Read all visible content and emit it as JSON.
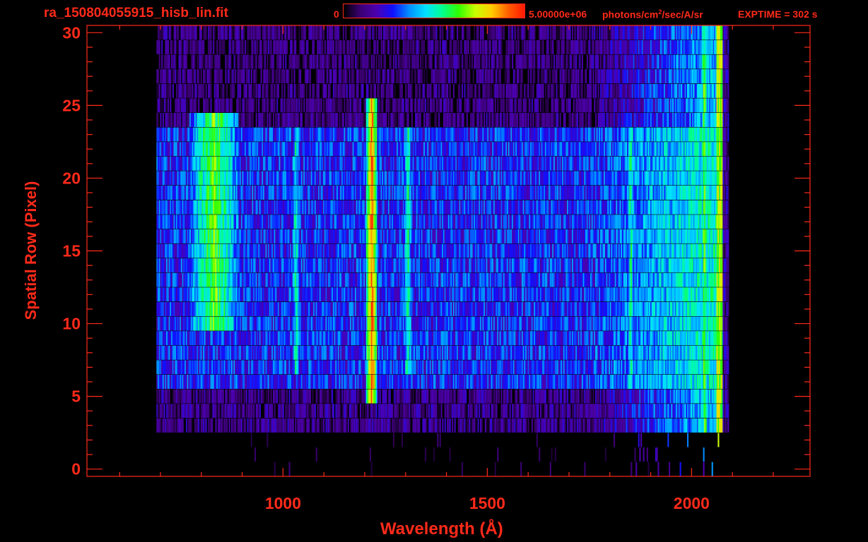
{
  "header": {
    "filename": "ra_150804055915_hisb_lin.fit",
    "colorbar_min": "0",
    "colorbar_max": "5.00000e+06",
    "colorbar_unit_pre": "photons/cm",
    "colorbar_unit_sup": "2",
    "colorbar_unit_post": "/sec/A/sr",
    "exptime": "EXPTIME = 302 s"
  },
  "colors": {
    "text": "#ff2a1a",
    "background": "#000000",
    "colormap": [
      "#000000",
      "#3a0070",
      "#4b00b0",
      "#1010ff",
      "#0090ff",
      "#00e0ff",
      "#00ff90",
      "#30ff00",
      "#c8ff00",
      "#ffcc00",
      "#ff6000",
      "#ff1800"
    ]
  },
  "chart_data": {
    "type": "heatmap",
    "title": "ra_150804055915_hisb_lin.fit",
    "xlabel": "Wavelength (Å)",
    "ylabel": "Spatial Row (Pixel)",
    "xlim": [
      520,
      2290
    ],
    "ylim": [
      -0.5,
      30.5
    ],
    "x_major_ticks": [
      1000,
      1500,
      2000
    ],
    "x_minor_step": 100,
    "y_major_ticks": [
      0,
      5,
      10,
      15,
      20,
      25,
      30
    ],
    "y_minor_step": 1,
    "colorbar": {
      "min": 0,
      "max": 5000000,
      "unit": "photons/cm^2/sec/A/sr"
    },
    "exptime_s": 302,
    "features": [
      {
        "name": "bright emission line",
        "wavelength": 1216,
        "rows": [
          5,
          25
        ],
        "level": 0.92
      },
      {
        "name": "line",
        "wavelength": 1304,
        "rows": [
          7,
          23
        ],
        "level": 0.55
      },
      {
        "name": "line",
        "wavelength": 1030,
        "rows": [
          7,
          23
        ],
        "level": 0.5
      },
      {
        "name": "slit image",
        "wavelength": 830,
        "rows": [
          10,
          24
        ],
        "level": 0.65
      },
      {
        "name": "continuum",
        "wavelength": 1850,
        "rows": [
          6,
          23
        ],
        "level": 0.55
      },
      {
        "name": "continuum",
        "wavelength": 2030,
        "rows": [
          3,
          30
        ],
        "level": 0.65
      }
    ]
  }
}
